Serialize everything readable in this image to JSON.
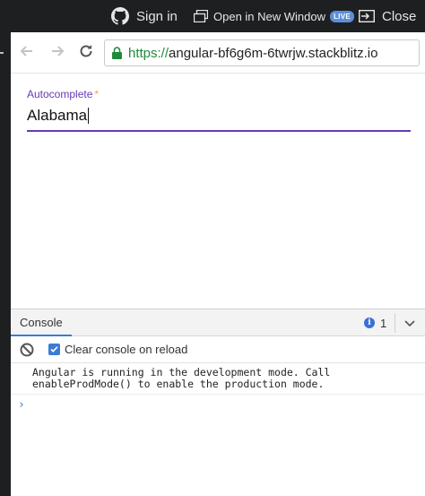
{
  "topbar": {
    "signin_label": "Sign in",
    "open_window_label": "Open in New Window",
    "live_badge": "LIVE",
    "close_label": "Close"
  },
  "browser": {
    "url_scheme": "https://",
    "url_host": "angular-bf6g6m-6twrjw.stackblitz.io"
  },
  "app": {
    "field_label": "Autocomplete",
    "required_mark": "*",
    "field_value": "Alabama"
  },
  "console": {
    "tab_label": "Console",
    "info_count": "1",
    "clear_on_reload_label": "Clear console on reload",
    "clear_on_reload_checked": true,
    "log_message": "Angular is running in the development mode. Call\nenableProdMode() to enable the production mode.",
    "prompt_symbol": "›"
  },
  "colors": {
    "accent": "#673ab7",
    "url_scheme": "#1f8a3b",
    "console_accent": "#3a7bd5"
  }
}
